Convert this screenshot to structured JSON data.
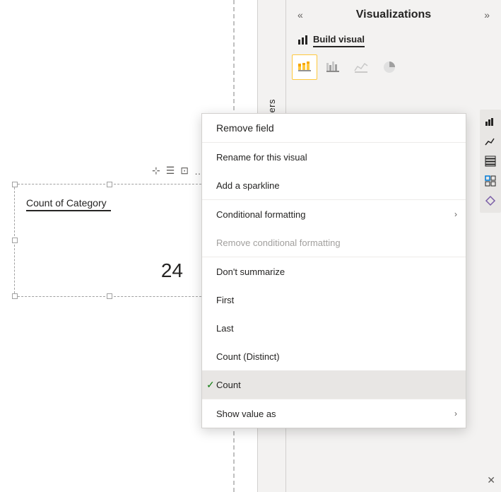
{
  "canvas": {
    "visual": {
      "title": "Count of Category",
      "value": "24",
      "toolbar_icons": [
        "pin",
        "filter",
        "expand",
        "more"
      ]
    }
  },
  "filter_strip": {
    "label": "Filters"
  },
  "viz_panel": {
    "title": "Visualizations",
    "arrow_left": "«",
    "arrow_right": "»",
    "build_visual_label": "Build visual"
  },
  "context_menu": {
    "items": [
      {
        "id": "remove-field",
        "label": "Remove field",
        "disabled": false,
        "checked": false,
        "has_arrow": false,
        "top": true
      },
      {
        "id": "rename",
        "label": "Rename for this visual",
        "disabled": false,
        "checked": false,
        "has_arrow": false
      },
      {
        "id": "sparkline",
        "label": "Add a sparkline",
        "disabled": false,
        "checked": false,
        "has_arrow": false
      },
      {
        "id": "conditional-fmt",
        "label": "Conditional formatting",
        "disabled": false,
        "checked": false,
        "has_arrow": true
      },
      {
        "id": "remove-conditional",
        "label": "Remove conditional formatting",
        "disabled": true,
        "checked": false,
        "has_arrow": false
      },
      {
        "id": "dont-summarize",
        "label": "Don't summarize",
        "disabled": false,
        "checked": false,
        "has_arrow": false
      },
      {
        "id": "first",
        "label": "First",
        "disabled": false,
        "checked": false,
        "has_arrow": false
      },
      {
        "id": "last",
        "label": "Last",
        "disabled": false,
        "checked": false,
        "has_arrow": false
      },
      {
        "id": "count-distinct",
        "label": "Count (Distinct)",
        "disabled": false,
        "checked": false,
        "has_arrow": false
      },
      {
        "id": "count",
        "label": "Count",
        "disabled": false,
        "checked": true,
        "has_arrow": false,
        "highlighted": true
      },
      {
        "id": "show-value-as",
        "label": "Show value as",
        "disabled": false,
        "checked": false,
        "has_arrow": true
      }
    ]
  },
  "icons": {
    "check": "✓",
    "arrow_right": "›",
    "pin": "📌",
    "more": "…",
    "bar_chart": "▦",
    "close": "✕"
  }
}
